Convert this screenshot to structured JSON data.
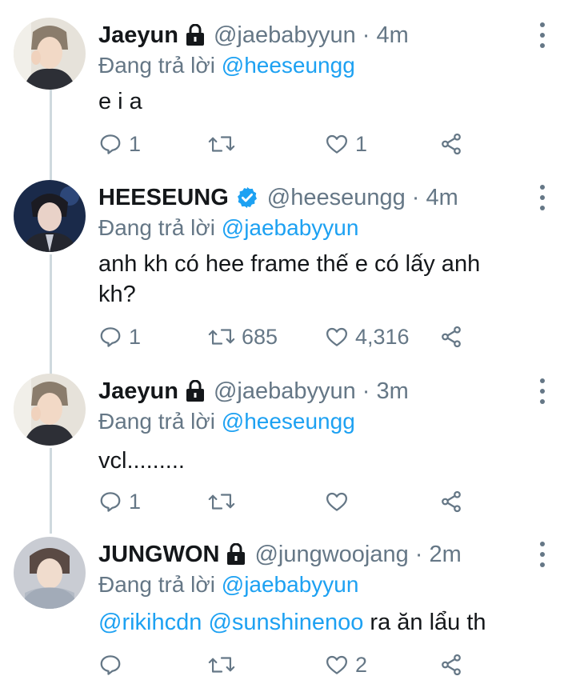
{
  "icons": {
    "lock": "lock-icon",
    "verified": "verified-badge-icon",
    "reply": "reply-icon",
    "retweet": "retweet-icon",
    "like": "heart-icon",
    "share": "share-icon",
    "more": "more-vertical-icon"
  },
  "colors": {
    "link": "#1da1f2",
    "secondary_text": "#657786",
    "primary_text": "#14171a",
    "verified": "#1da1f2",
    "thread_line": "#cfd9de"
  },
  "tweets": [
    {
      "name": "Jaeyun",
      "badge": "lock",
      "handle_time": "@jaebabyyun · 4m",
      "replying_prefix": "Đang trả lời ",
      "replying_to": "@heeseungg",
      "text_line1": "e i a",
      "text_line2": "",
      "mentions": [],
      "replies": "1",
      "retweets": "",
      "likes": "1"
    },
    {
      "name": "HEESEUNG",
      "badge": "verified",
      "handle_time": "@heeseungg · 4m",
      "replying_prefix": "Đang trả lời ",
      "replying_to": "@jaebabyyun",
      "text_line1": "anh kh có hee frame thế e có lấy anh",
      "text_line2": "kh?",
      "mentions": [],
      "replies": "1",
      "retweets": "685",
      "likes": "4,316"
    },
    {
      "name": "Jaeyun",
      "badge": "lock",
      "handle_time": "@jaebabyyun · 3m",
      "replying_prefix": "Đang trả lời ",
      "replying_to": "@heeseungg",
      "text_line1": "vcl.........",
      "text_line2": "",
      "mentions": [],
      "replies": "1",
      "retweets": "",
      "likes": ""
    },
    {
      "name": "JUNGWON",
      "badge": "lock",
      "handle_time": "@jungwoojang · 2m",
      "replying_prefix": "Đang trả lời ",
      "replying_to": "@jaebabyyun",
      "mention1": "@rikihcdn",
      "mention2": "@sunshinenoo",
      "text_rest": " ra ăn lẩu th",
      "replies": "",
      "retweets": "",
      "likes": "2"
    }
  ]
}
